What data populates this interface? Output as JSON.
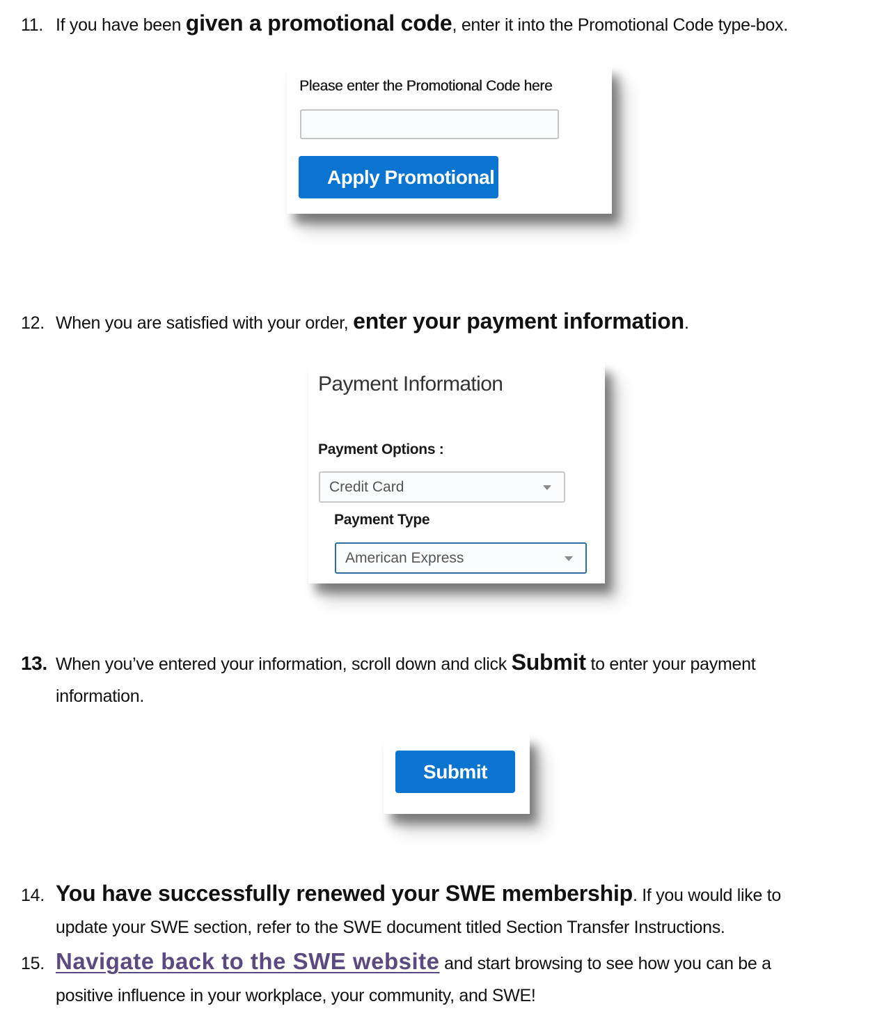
{
  "steps": {
    "s11": {
      "number": "11.",
      "pre": "If you have been ",
      "bold": "given a promotional code",
      "post": ", enter it into the Promotional Code type-box."
    },
    "s12": {
      "number": "12.",
      "pre": "When you are satisfied with your order, ",
      "bold": "enter your payment information",
      "post": "."
    },
    "s13": {
      "number": "13.",
      "pre": "When you’ve entered your information, scroll down and click ",
      "bold": "Submit",
      "post": " to enter your payment",
      "line2": "information."
    },
    "s14": {
      "number": "14.",
      "bold": "You have successfully renewed your SWE membership",
      "post": ". If you would like to",
      "line2": "update your SWE section, refer to the SWE document titled Section Transfer Instructions."
    },
    "s15": {
      "number": "15.",
      "link": "Navigate back to the SWE website",
      "post": " and start browsing to see how you can be a",
      "line2": "positive influence in your workplace, your community, and SWE!"
    }
  },
  "promo_panel": {
    "label": "Please enter the Promotional Code here",
    "input_value": "",
    "button_label": "Apply Promotional"
  },
  "payment_panel": {
    "title": "Payment Information",
    "options_label": "Payment Options :",
    "options_selected": "Credit Card",
    "type_label": "Payment Type",
    "type_selected": "American Express"
  },
  "submit_panel": {
    "button_label": "Submit"
  },
  "colors": {
    "button_blue": "#0b74d1",
    "link_purple": "#5b4a7f",
    "focused_select_border": "#2c6da6"
  }
}
